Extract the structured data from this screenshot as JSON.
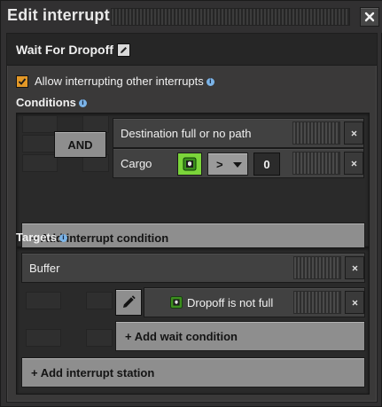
{
  "window": {
    "title": "Edit interrupt"
  },
  "interrupt": {
    "name": "Wait For Dropoff"
  },
  "options": {
    "allow_interrupting_label": "Allow interrupting other interrupts",
    "allow_interrupting_checked": true
  },
  "conditions": {
    "title": "Conditions",
    "logic_button": "AND",
    "rows": [
      {
        "label": "Destination full or no path"
      },
      {
        "label": "Cargo",
        "comparator": ">",
        "value": "0",
        "item_icon": "green-circuit-icon"
      }
    ],
    "add_label": "+ Add interrupt condition"
  },
  "targets": {
    "title": "Targets",
    "station": "Buffer",
    "wait_condition": {
      "label": "Dropoff is not full",
      "icon": "green-circuit-icon"
    },
    "add_wait_label": "+ Add wait condition",
    "add_station_label": "+ Add interrupt station"
  },
  "colors": {
    "checkbox": "#e39827",
    "item_slot": "#7bd53a",
    "info": "#7bb4e8"
  }
}
